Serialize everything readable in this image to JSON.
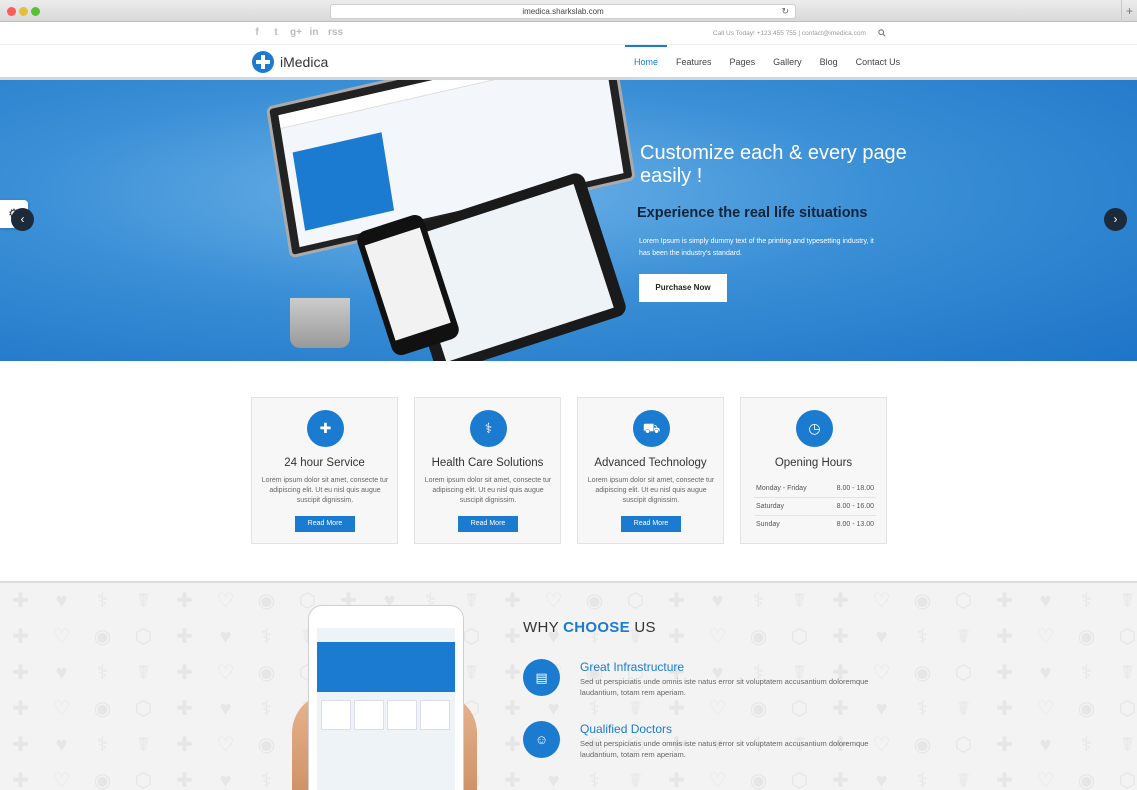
{
  "browser": {
    "url": "imedica.sharkslab.com"
  },
  "topbar": {
    "social": [
      "f",
      "t",
      "g+",
      "in",
      "rss"
    ],
    "contact": "Call Us Today! +123 455 755 | contact@imedica.com"
  },
  "nav": {
    "logo": "iMedica",
    "items": [
      "Home",
      "Features",
      "Pages",
      "Gallery",
      "Blog",
      "Contact Us"
    ],
    "active": "Home"
  },
  "hero": {
    "title": "Customize each & every page easily !",
    "subtitle": "Experience the real life situations",
    "text": "Lorem Ipsum is simply dummy text of the printing and typesetting industry, it has been the industry's standard.",
    "button": "Purchase Now"
  },
  "features": [
    {
      "title": "24 hour Service",
      "icon": "medkit-icon",
      "text": "Lorem ipsum dolor sit amet, consecte tur adipiscing elit. Ut eu nisl quis augue suscipit dignissim.",
      "button": "Read More"
    },
    {
      "title": "Health Care Solutions",
      "icon": "stethoscope-icon",
      "text": "Lorem ipsum dolor sit amet, consecte tur adipiscing elit. Ut eu nisl quis augue suscipit dignissim.",
      "button": "Read More"
    },
    {
      "title": "Advanced Technology",
      "icon": "ambulance-icon",
      "text": "Lorem ipsum dolor sit amet, consecte tur adipiscing elit. Ut eu nisl quis augue suscipit dignissim.",
      "button": "Read More"
    },
    {
      "title": "Opening Hours",
      "icon": "clock-icon"
    }
  ],
  "hours": [
    {
      "day": "Monday - Friday",
      "time": "8.00 - 18.00"
    },
    {
      "day": "Saturday",
      "time": "8.00 - 16.00"
    },
    {
      "day": "Sunday",
      "time": "8.00 - 13.00"
    }
  ],
  "why": {
    "title_prefix": "WHY",
    "title_highlight": "CHOOSE",
    "title_suffix": "US",
    "items": [
      {
        "title": "Great Infrastructure",
        "icon": "hospital-icon",
        "text": "Sed ut perspiciatis unde omnis iste natus error sit voluptatem accusantium doloremque laudantium, totam rem aperiam."
      },
      {
        "title": "Qualified Doctors",
        "icon": "doctor-icon",
        "text": "Sed ut perspiciatis unde omnis iste natus error sit voluptatem accusantium doloremque laudantium, totam rem aperiam."
      }
    ]
  },
  "colors": {
    "brand": "#1a7bd1",
    "dark": "#11243a"
  }
}
